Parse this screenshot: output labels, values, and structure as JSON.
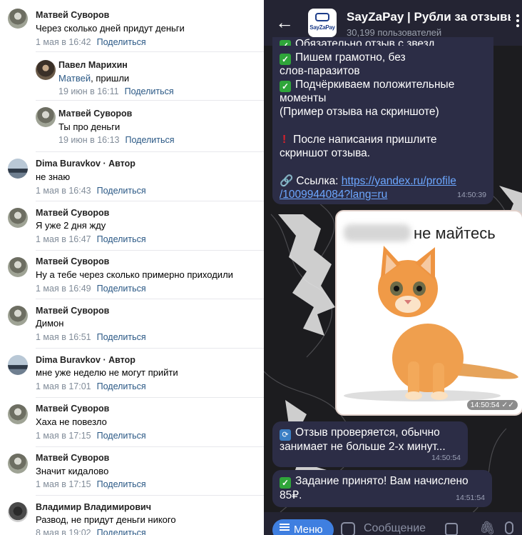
{
  "vk": {
    "share_label": "Поделиться",
    "comments": [
      {
        "author": "Матвей Суворов",
        "text": "Через сколько дней придут деньги",
        "time": "1 мая в 16:42"
      },
      {
        "author": "Павел Марихин",
        "mention": "Матвей",
        "text": ", пришли",
        "time": "19 июн в 16:11"
      },
      {
        "author": "Матвей Суворов",
        "text": "Ты про деньги",
        "time": "19 июн в 16:13"
      },
      {
        "author": "Dima Buravkov",
        "author_tag": " · Автор",
        "text": "не знаю",
        "time": "1 мая в 16:43"
      },
      {
        "author": "Матвей Суворов",
        "text": "Я уже 2 дня жду",
        "time": "1 мая в 16:47"
      },
      {
        "author": "Матвей Суворов",
        "text": "Ну а тебе через сколько примерно приходили",
        "time": "1 мая в 16:49"
      },
      {
        "author": "Матвей Суворов",
        "text": "Димон",
        "time": "1 мая в 16:51"
      },
      {
        "author": "Dima Buravkov",
        "author_tag": " · Автор",
        "text": "мне уже неделю не могут прийти",
        "time": "1 мая в 17:01"
      },
      {
        "author": "Матвей Суворов",
        "text": "Хаха не повезло",
        "time": "1 мая в 17:15"
      },
      {
        "author": "Матвей Суворов",
        "text": "Значит кидалово",
        "time": "1 мая в 17:15"
      },
      {
        "author": "Владимир Владимирович",
        "text": "Развод, не придут деньги никого",
        "time": "8 мая в 19:02"
      }
    ]
  },
  "tg": {
    "back_icon": "arrow-left-icon",
    "channel_title": "SayZaPay | Рубли за отзывы",
    "logo_text": "SayZaPay",
    "subscribers": "30,199 пользователей",
    "msg1": {
      "lines": [
        "Обязательно отзыв с звезд",
        "Пишем грамотно, без",
        "слов-паразитов",
        "Подчёркиваем положительные",
        "моменты",
        "(Пример отзыва на скриншоте)",
        "После написания пришлите",
        "скриншот отзыва.",
        "Ссылка: ",
        "https://yandex.ru/profile",
        "/1009944084?lang=ru"
      ],
      "time": "14:50:39"
    },
    "photo": {
      "caption": "не майтесь",
      "time": "14:50:54"
    },
    "msg2": {
      "lines": [
        "Отзыв проверяется, обычно",
        "занимает не больше 2-х минут..."
      ],
      "time": "14:50:54"
    },
    "msg3": {
      "lines": [
        "Задание принято! Вам начислено",
        "85₽."
      ],
      "time": "14:51:54"
    },
    "bottom": {
      "menu_label": "Меню",
      "input_placeholder": "Сообщение"
    },
    "colors": {
      "accent": "#3f7fe0",
      "header": "#242433",
      "bubble": "#2c2d46",
      "check": "#2fa53a"
    }
  }
}
